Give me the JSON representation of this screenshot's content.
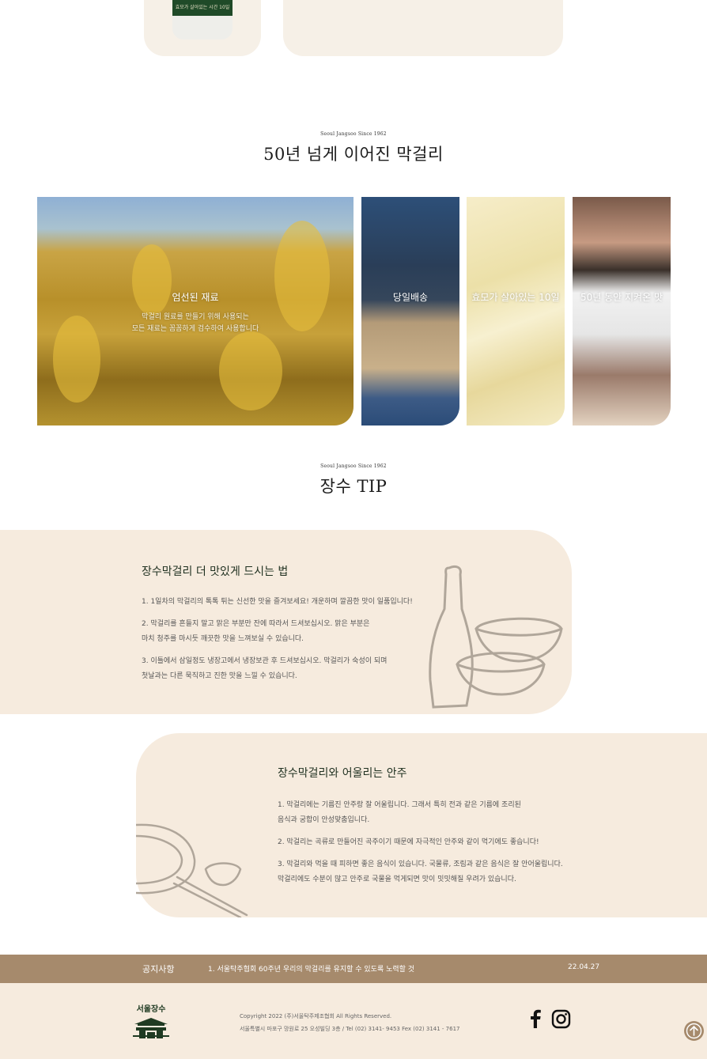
{
  "top": {
    "bottle_label": "효모가 살아있는 시간 10일"
  },
  "history": {
    "subtitle": "Seoul Jangsoo Since 1962",
    "title": "50년 넘게 이어진 막걸리",
    "panels": [
      {
        "caption": "엄선된 재료",
        "desc_line1": "막걸리 원료를 만들기 위해 사용되는",
        "desc_line2": "모든 재료는 꼼꼼하게 검수하여 사용합니다"
      },
      {
        "caption": "당일배송"
      },
      {
        "caption": "효모가 살아있는 10일"
      },
      {
        "caption": "50년 동안 지켜온 맛"
      }
    ]
  },
  "tip": {
    "subtitle": "Seoul Jangsoo Since 1962",
    "title": "장수 TIP",
    "card1": {
      "title": "장수막걸리 더 맛있게 드시는 법",
      "lines": [
        "1. 1일차의 막걸리의 톡톡 튀는 신선한 맛을 즐겨보세요! 개운하며 깔끔한 맛이 일품입니다!",
        "2. 막걸리를 흔들지 말고 맑은 부분만 잔에 따라서 드셔보십시오. 맑은 부분은",
        "마치 청주를 마시듯 깨끗한 맛을 느껴보실 수 있습니다.",
        "3. 이틀에서 삼일정도 냉장고에서 냉장보관 후 드셔보십시오. 막걸리가 숙성이 되며",
        "첫날과는 다른 묵직하고 진한 맛을 느낄 수 있습니다."
      ]
    },
    "card2": {
      "title": "장수막걸리와 어울리는 안주",
      "lines": [
        "1. 막걸리에는 기름진 안주랑 잘 어울립니다. 그래서 특히 전과 같은 기름에 조리된",
        "음식과 궁합이 안성맞춤입니다.",
        "2. 막걸리는 곡류로 만들어진 곡주이기 때문에 자극적인 안주와 같이 먹기에도 좋습니다!",
        "3. 막걸리와 먹을 때 피하면 좋은 음식이 있습니다. 국물류, 조림과 같은 음식은 잘 안어울립니다.",
        "막걸리에도 수분이 많고 안주로 국물을 먹게되면 맛이 밋밋해질 우려가 있습니다."
      ]
    }
  },
  "notice": {
    "label": "공지사항",
    "text": "1. 서울탁주협회 60주년 우리의 막걸리를 유지할 수 있도록 노력할 것",
    "date": "22.04.27"
  },
  "footer": {
    "logo_text": "서울장수",
    "copyright": "Copyright 2022 (주)서울탁주제조협회 All Rights Reserved.",
    "address": "서울특별시 마포구 망원로 25 오성빌딩 3층  /  Tel (02) 3141- 9453 Fex (02) 3141 - 7617"
  },
  "colors": {
    "accent": "#a68a6c",
    "card_bg": "#f6ebde",
    "brand_green": "#1f3a22"
  },
  "icons": {
    "facebook": "facebook-icon",
    "instagram": "instagram-icon",
    "top": "arrow-up-icon"
  }
}
